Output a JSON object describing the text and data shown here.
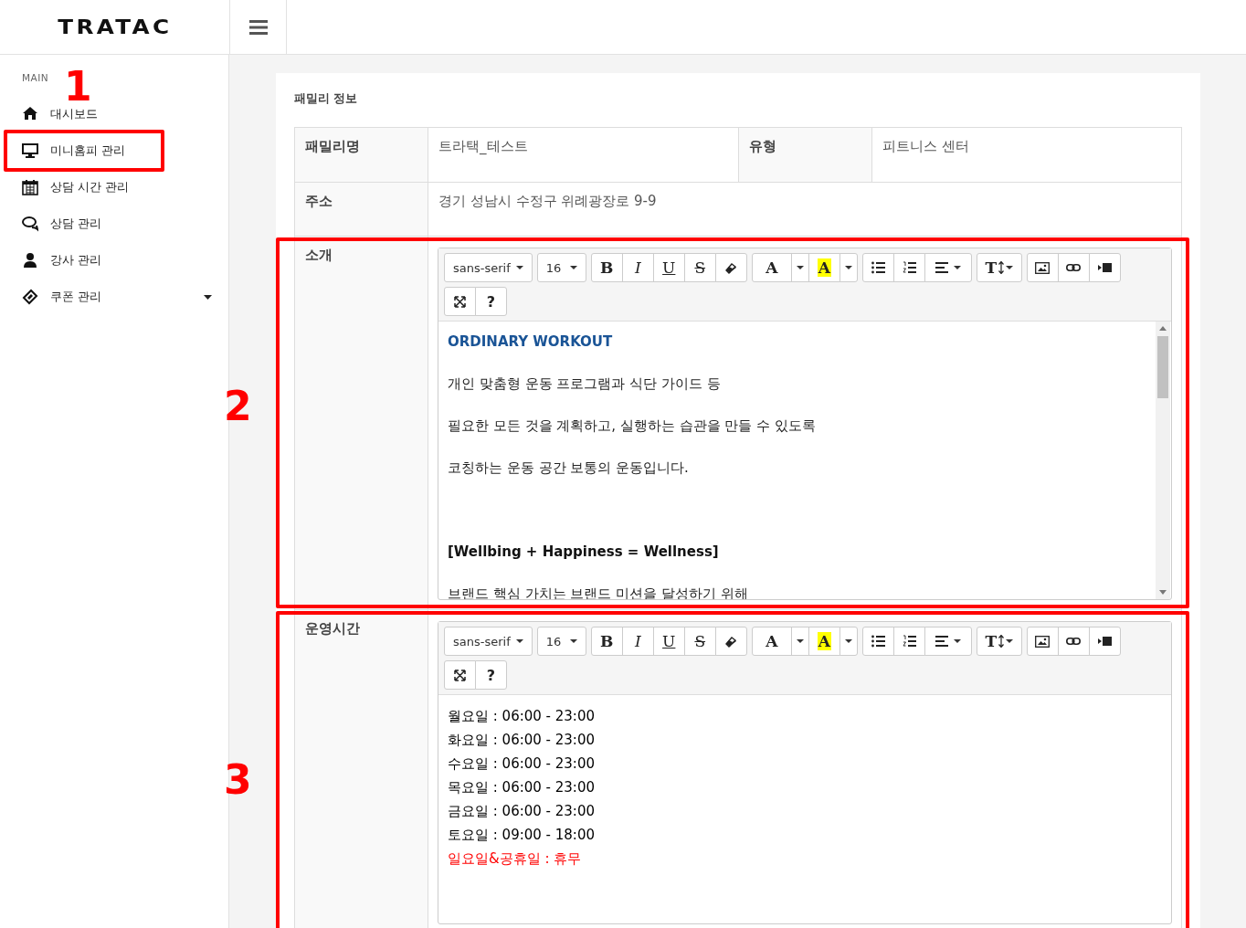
{
  "header": {
    "logo": "TRATAC"
  },
  "sidebar": {
    "section": "MAIN",
    "items": [
      {
        "label": "대시보드",
        "selected": false,
        "has_submenu": false
      },
      {
        "label": "미니홈피 관리",
        "selected": false,
        "has_submenu": false,
        "annotation": "1"
      },
      {
        "label": "상담 시간 관리",
        "selected": false,
        "has_submenu": false
      },
      {
        "label": "상담 관리",
        "selected": false,
        "has_submenu": false
      },
      {
        "label": "강사 관리",
        "selected": false,
        "has_submenu": false
      },
      {
        "label": "쿠폰 관리",
        "selected": false,
        "has_submenu": true
      }
    ]
  },
  "family_info": {
    "title": "패밀리 정보",
    "name_label": "패밀리명",
    "name_value": "트라택_테스트",
    "type_label": "유형",
    "type_value": "피트니스 센터",
    "address_label": "주소",
    "address_value": "경기 성남시 수정구 위례광장로 9-9",
    "editors": [
      {
        "label": "소개",
        "annotation": "2",
        "scrollbar": true,
        "toolbar": {
          "font_family": "sans-serif",
          "font_size": "16",
          "bold": "B",
          "italic": "I",
          "underline": "U",
          "strikethrough": "S",
          "text_color": "A",
          "highlight": "A",
          "text_size": "T",
          "help": "?"
        },
        "paragraphs": [
          {
            "kind": "heading",
            "text": "ORDINARY WORKOUT"
          },
          {
            "kind": "text",
            "text": "개인 맞춤형 운동 프로그램과 식단 가이드 등"
          },
          {
            "kind": "text",
            "text": "필요한 모든 것을 계획하고, 실행하는 습관을 만들 수 있도록"
          },
          {
            "kind": "text",
            "text": "코칭하는 운동 공간 보통의 운동입니다."
          },
          {
            "kind": "blank"
          },
          {
            "kind": "bold",
            "text": "[Wellbing + Happiness = Wellness]"
          },
          {
            "kind": "text",
            "text": "브랜드 핵심 가치는 브랜드 미션을 달성하기 위해"
          }
        ]
      },
      {
        "label": "운영시간",
        "annotation": "3",
        "scrollbar": false,
        "toolbar": {
          "font_family": "sans-serif",
          "font_size": "16",
          "bold": "B",
          "italic": "I",
          "underline": "U",
          "strikethrough": "S",
          "text_color": "A",
          "highlight": "A",
          "text_size": "T",
          "help": "?"
        },
        "lines": [
          {
            "text": "월요일 : 06:00 - 23:00",
            "color": "#000000"
          },
          {
            "text": "화요일 : 06:00 - 23:00",
            "color": "#000000"
          },
          {
            "text": "수요일 : 06:00 - 23:00",
            "color": "#000000"
          },
          {
            "text": "목요일 : 06:00 - 23:00",
            "color": "#000000"
          },
          {
            "text": "금요일 : 06:00 - 23:00",
            "color": "#000000"
          },
          {
            "text": "토요일 : 09:00 - 18:00",
            "color": "#000000"
          },
          {
            "text": "일요일&공휴일 : 휴무",
            "color": "#ff0000"
          }
        ]
      }
    ]
  }
}
